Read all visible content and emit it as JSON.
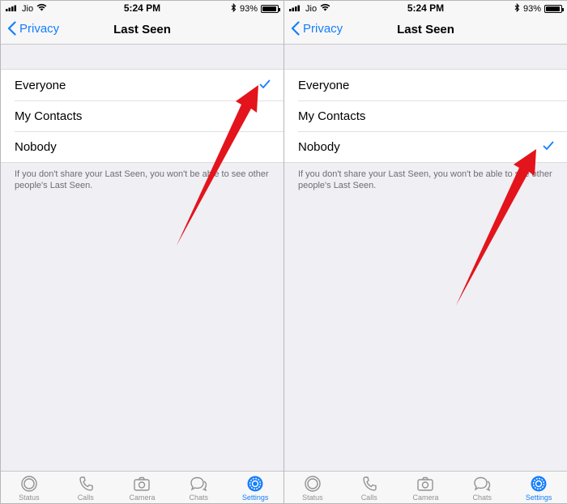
{
  "status_bar": {
    "carrier": "Jio",
    "time": "5:24 PM",
    "battery": "93%",
    "battery_level": 0.93
  },
  "nav": {
    "back_label": "Privacy",
    "title": "Last Seen"
  },
  "options": [
    "Everyone",
    "My Contacts",
    "Nobody"
  ],
  "footnote": "If you don't share your Last Seen, you won't be able to see other people's Last Seen.",
  "tabs": [
    "Status",
    "Calls",
    "Camera",
    "Chats",
    "Settings"
  ],
  "active_tab": "Settings",
  "panels": [
    {
      "selected_option": "Everyone"
    },
    {
      "selected_option": "Nobody"
    }
  ],
  "colors": {
    "accent": "#157efb",
    "annotation_arrow": "#e3141c",
    "background": "#efeff4"
  },
  "icons": [
    "chevron-left-icon",
    "wifi-icon",
    "bluetooth-icon",
    "battery-icon",
    "checkmark-icon",
    "status-icon",
    "calls-icon",
    "camera-icon",
    "chats-icon",
    "settings-icon",
    "annotation-arrow"
  ]
}
